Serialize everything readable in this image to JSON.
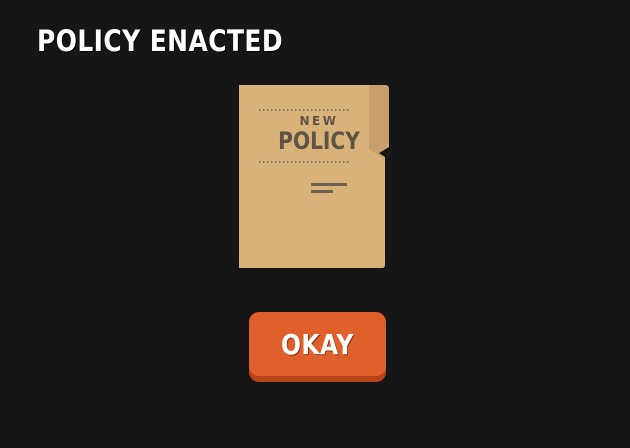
{
  "screen": {
    "title": "POLICY ENACTED"
  },
  "folder": {
    "icon": "policy-folder-icon",
    "label_small": "NEW",
    "label_big": "POLICY",
    "colors": {
      "paper": "#d9b27a",
      "tab": "#c9a06b",
      "ink": "#5e5446"
    }
  },
  "okay_button": {
    "label": "OKAY",
    "colors": {
      "face": "#e0602b",
      "shadow": "#b94419"
    }
  },
  "background": "#161616"
}
